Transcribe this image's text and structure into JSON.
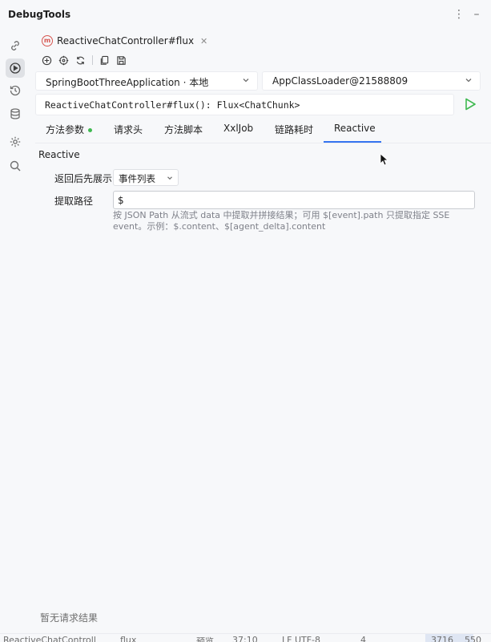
{
  "app": {
    "title": "DebugTools"
  },
  "sidebar": {
    "icons": [
      "link-icon",
      "run-icon",
      "history-icon",
      "database-icon",
      "settings-icon",
      "search-icon"
    ]
  },
  "editor_tab": {
    "label": "ReactiveChatController#flux",
    "icon": "m"
  },
  "toolbar": {
    "icons": [
      "add-icon",
      "target-icon",
      "refresh-icon",
      "copy-icon",
      "save-icon"
    ]
  },
  "selects": {
    "application": "SpringBootThreeApplication · 本地",
    "classloader": "AppClassLoader@21588809"
  },
  "signature": "ReactiveChatController#flux(): Flux<ChatChunk>",
  "param_tabs": [
    {
      "label": "方法参数",
      "dot": true
    },
    {
      "label": "请求头"
    },
    {
      "label": "方法脚本"
    },
    {
      "label": "XxlJob"
    },
    {
      "label": "链路耗时"
    },
    {
      "label": "Reactive",
      "active": true
    }
  ],
  "reactive": {
    "title": "Reactive",
    "display_label": "返回后先展示",
    "display_value": "事件列表",
    "path_label": "提取路径",
    "path_value": "$",
    "hint": "按 JSON Path 从流式 data 中提取并拼接结果；可用 $[event].path 只提取指定 SSE event。示例：$.content、$[agent_delta].content"
  },
  "result": {
    "empty_text": "暂无请求结果"
  },
  "status": {
    "left": "ReactiveChatControll",
    "mid": "flux",
    "mid2": "预览",
    "pos": "37:10",
    "enc": "LF  UTF-8",
    "indent": "4",
    "right": "3716",
    "right2": "550"
  },
  "colors": {
    "accent": "#3574f0",
    "run": "#3fb950",
    "dot": "#3fb950",
    "m_icon": "#d6534e"
  }
}
